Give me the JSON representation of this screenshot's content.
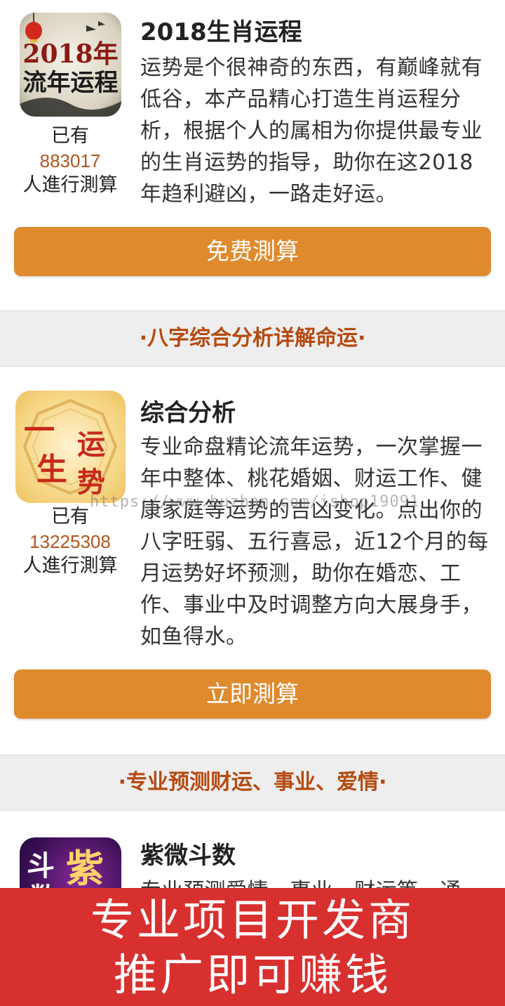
{
  "products": [
    {
      "title": "2018生肖运程",
      "icon_text_line1": "2018年",
      "icon_text_line2": "流年运程",
      "count_prefix": "已有",
      "count": "883017",
      "count_suffix": "人進行測算",
      "description": "运势是个很神奇的东西，有巅峰就有低谷，本产品精心打造生肖运程分析，根据个人的属相为你提供最专业的生肖运势的指导，助你在这2018年趋利避凶，一路走好运。",
      "button_label": "免费測算"
    },
    {
      "title": "综合分析",
      "icon_chars": [
        "一",
        "生",
        "运",
        "势"
      ],
      "count_prefix": "已有",
      "count": "13225308",
      "count_suffix": "人進行測算",
      "description": "专业命盘精论流年运势，一次掌握一年中整体、桃花婚姻、财运工作、健康家庭等运势的吉凶变化。点出你的八字旺弱、五行喜忌，近12个月的每月运势好坏预测，助你在婚恋、工作、事业中及时调整方向大展身手，如鱼得水。",
      "button_label": "立即測算"
    },
    {
      "title": "紫微斗数",
      "icon_chars": [
        "斗",
        "紫",
        "数"
      ],
      "description": "专业预测爱情、事业、财运等，通"
    }
  ],
  "sections": [
    {
      "heading": "·八字综合分析详解命运·"
    },
    {
      "heading": "·专业预测财运、事业、爱情·"
    }
  ],
  "watermark": "https://www.huzhan.com/ishop19091",
  "banner": {
    "line1": "专业项目开发商",
    "line2": "推广即可赚钱"
  },
  "colors": {
    "button": "#e08a2e",
    "section_text": "#b44a10",
    "count_text": "#b0561e",
    "banner": "#d8302f"
  }
}
